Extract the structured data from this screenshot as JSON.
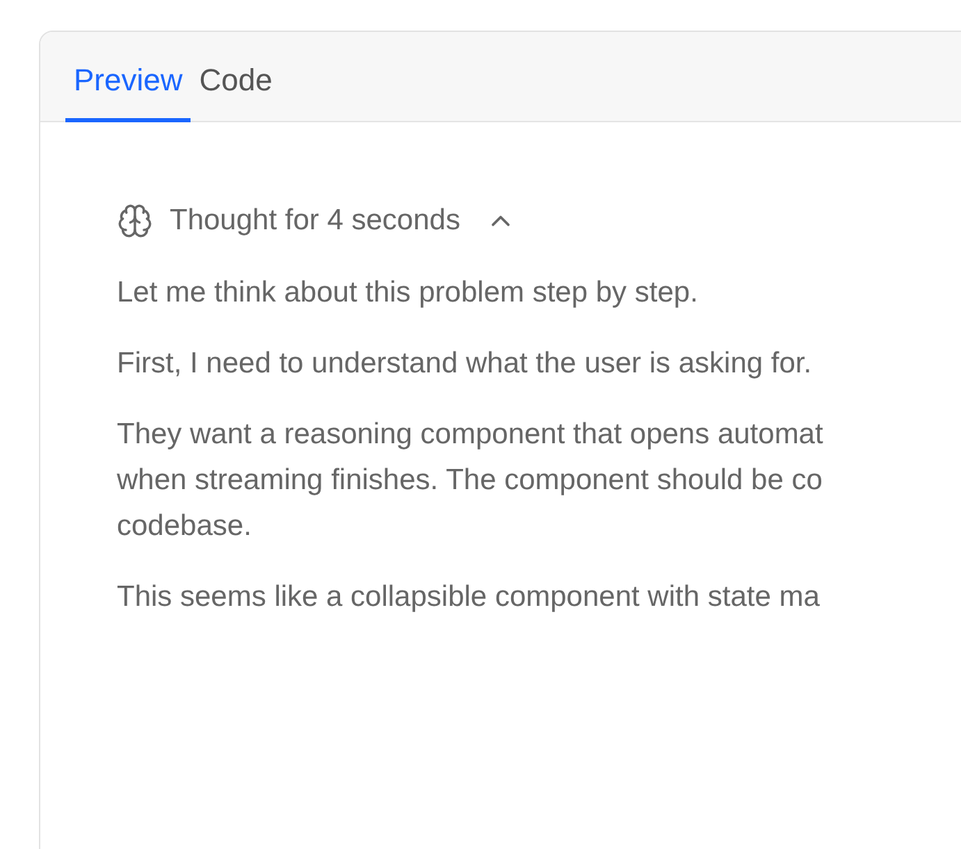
{
  "tabs": [
    {
      "label": "Preview",
      "selected": true
    },
    {
      "label": "Code",
      "selected": false
    }
  ],
  "reasoning": {
    "title": "Thought for 4 seconds",
    "expanded": true,
    "paragraphs": [
      {
        "lines": [
          "Let me think about this problem step by step."
        ]
      },
      {
        "lines": [
          "First, I need to understand what the user is asking for."
        ]
      },
      {
        "lines": [
          "They want a reasoning component that opens automat",
          "when streaming finishes. The component should be co",
          "codebase."
        ]
      },
      {
        "lines": [
          "This seems like a collapsible component with state ma"
        ]
      }
    ]
  }
}
